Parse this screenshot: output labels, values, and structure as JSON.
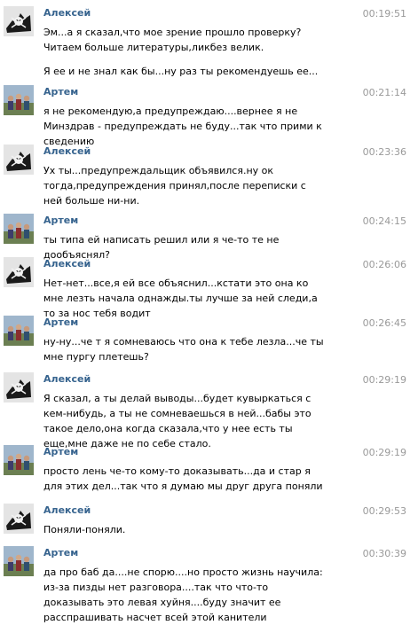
{
  "messages": [
    {
      "author": "Алексей",
      "avatar": "pirate-skull-avatar",
      "time": "00:19:51",
      "paragraphs": [
        "Эм...а я сказал,что мое зрение прошло проверку?Читаем больше литературы,ликбез велик.",
        "Я ее и не знал как бы...ну раз ты рекомендуешь ее..."
      ]
    },
    {
      "author": "Артем",
      "avatar": "group-photo-avatar",
      "time": "00:21:14",
      "paragraphs": [
        "я не рекомендую,а предупреждаю....вернее я не Минздрав - предупреждать не буду...так что прими к сведению"
      ]
    },
    {
      "author": "Алексей",
      "avatar": "pirate-skull-avatar",
      "time": "00:23:36",
      "paragraphs": [
        "Ух ты...предупреждальщик объявился.ну ок тогда,предупреждения принял,после переписки с ней больше ни-ни."
      ]
    },
    {
      "author": "Артем",
      "avatar": "group-photo-avatar",
      "time": "00:24:15",
      "paragraphs": [
        "ты типа ей написать решил или я че-то те не дообъяснял?"
      ]
    },
    {
      "author": "Алексей",
      "avatar": "pirate-skull-avatar",
      "time": "00:26:06",
      "paragraphs": [
        "Нет-нет...все,я ей все объяснил...кстати это она ко мне лезть начала однажды.ты лучше за ней следи,а то за нос тебя водит"
      ]
    },
    {
      "author": "Артем",
      "avatar": "group-photo-avatar",
      "time": "00:26:45",
      "paragraphs": [
        "ну-ну...че т я сомневаюсь что она к тебе лезла...че ты мне пургу плетешь?"
      ]
    },
    {
      "author": "Алексей",
      "avatar": "pirate-skull-avatar",
      "time": "00:29:19",
      "paragraphs": [
        "Я сказал, а ты делай выводы...будет кувыркаться с кем-нибудь, а ты не сомневаешься в ней...бабы это такое дело,она когда сказала,что у нее есть ты еще,мне даже не по себе стало."
      ]
    },
    {
      "author": "Артем",
      "avatar": "group-photo-avatar",
      "time": "00:29:19",
      "paragraphs": [
        "просто лень че-то кому-то доказывать...да и стар я для этих дел...так что я думаю мы друг друга поняли"
      ]
    },
    {
      "author": "Алексей",
      "avatar": "pirate-skull-avatar",
      "time": "00:29:53",
      "paragraphs": [
        "Поняли-поняли."
      ]
    },
    {
      "author": "Артем",
      "avatar": "group-photo-avatar",
      "time": "00:30:39",
      "paragraphs": [
        "да про баб да....не спорю....но просто жизнь научила: из-за пизды нет разговора....так что что-то доказывать это левая хуйня....буду значит ее расспрашивать насчет всей этой канители"
      ]
    }
  ]
}
